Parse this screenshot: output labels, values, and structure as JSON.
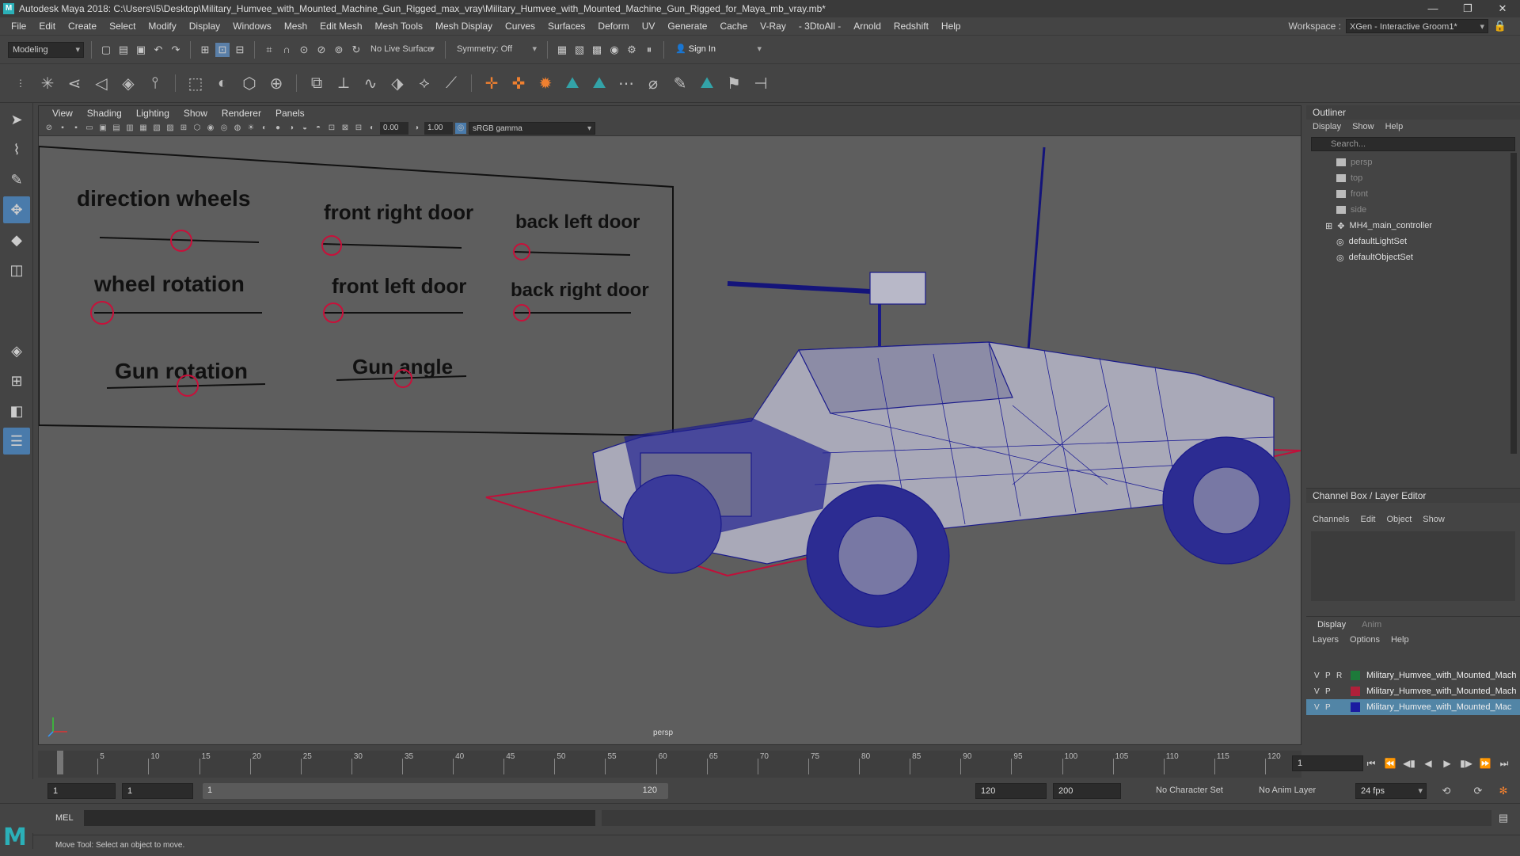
{
  "window": {
    "title": "Autodesk Maya 2018: C:\\Users\\I5\\Desktop\\Military_Humvee_with_Mounted_Machine_Gun_Rigged_max_vray\\Military_Humvee_with_Mounted_Machine_Gun_Rigged_for_Maya_mb_vray.mb*",
    "minimize": "—",
    "maximize": "❐",
    "close": "✕"
  },
  "menubar": {
    "items": [
      "File",
      "Edit",
      "Create",
      "Select",
      "Modify",
      "Display",
      "Windows",
      "Mesh",
      "Edit Mesh",
      "Mesh Tools",
      "Mesh Display",
      "Curves",
      "Surfaces",
      "Deform",
      "UV",
      "Generate",
      "Cache",
      "V-Ray",
      "- 3DtoAll -",
      "Arnold",
      "Redshift",
      "Help"
    ],
    "workspace_label": "Workspace :",
    "workspace_value": "XGen - Interactive Groom1*"
  },
  "statusline": {
    "mode": "Modeling",
    "live_surface": "No Live Surface",
    "symmetry": "Symmetry: Off",
    "sign_in": "Sign In"
  },
  "viewport": {
    "menu": [
      "View",
      "Shading",
      "Lighting",
      "Show",
      "Renderer",
      "Panels"
    ],
    "exposure": "0.00",
    "gamma": "1.00",
    "color_space": "sRGB gamma",
    "camera": "persp",
    "controls": {
      "direction_wheels": "direction wheels",
      "front_right_door": "front right door",
      "back_left_door": "back left door",
      "wheel_rotation": "wheel rotation",
      "front_left_door": "front left door",
      "back_right_door": "back right door",
      "gun_rotation": "Gun rotation",
      "gun_angle": "Gun angle"
    }
  },
  "outliner": {
    "title": "Outliner",
    "menu": [
      "Display",
      "Show",
      "Help"
    ],
    "search_placeholder": "Search...",
    "items": [
      {
        "label": "persp",
        "dim": true
      },
      {
        "label": "top",
        "dim": true
      },
      {
        "label": "front",
        "dim": true
      },
      {
        "label": "side",
        "dim": true
      },
      {
        "label": "MH4_main_controller",
        "dim": false
      },
      {
        "label": "defaultLightSet",
        "dim": false
      },
      {
        "label": "defaultObjectSet",
        "dim": false
      }
    ]
  },
  "channelbox": {
    "title": "Channel Box / Layer Editor",
    "menu": [
      "Channels",
      "Edit",
      "Object",
      "Show"
    ]
  },
  "layers": {
    "tabs": [
      "Display",
      "Anim"
    ],
    "menu": [
      "Layers",
      "Options",
      "Help"
    ],
    "rows": [
      {
        "v": "V",
        "p": "P",
        "r": "R",
        "color": "#1d7a3a",
        "name": "Military_Humvee_with_Mounted_Mach"
      },
      {
        "v": "V",
        "p": "P",
        "r": "",
        "color": "#b0203a",
        "name": "Military_Humvee_with_Mounted_Mach"
      },
      {
        "v": "V",
        "p": "P",
        "r": "",
        "color": "#1b1ba0",
        "name": "Military_Humvee_with_Mounted_Mac"
      }
    ]
  },
  "timeslider": {
    "ticks": [
      "1",
      "5",
      "10",
      "15",
      "20",
      "25",
      "30",
      "35",
      "40",
      "45",
      "50",
      "55",
      "60",
      "65",
      "70",
      "75",
      "80",
      "85",
      "90",
      "95",
      "100",
      "105",
      "110",
      "115",
      "120"
    ],
    "current_frame": "1"
  },
  "range": {
    "start": "1",
    "playback_start": "1",
    "slider_start": "1",
    "slider_end": "120",
    "playback_end": "120",
    "end": "200",
    "character_set": "No Character Set",
    "anim_layer": "No Anim Layer",
    "fps": "24 fps"
  },
  "mel": {
    "label": "MEL"
  },
  "status": {
    "help_line": "Move Tool: Select an object to move."
  }
}
